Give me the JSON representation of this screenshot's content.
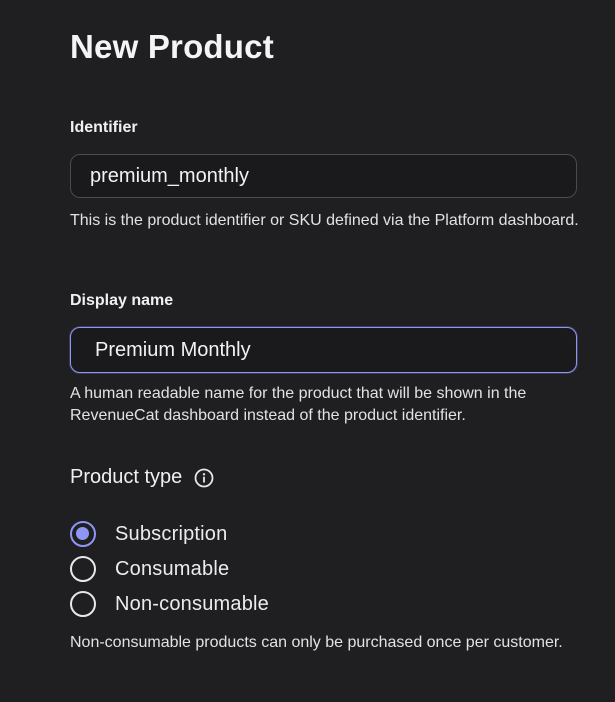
{
  "page": {
    "title": "New Product"
  },
  "identifier": {
    "label": "Identifier",
    "value": "premium_monthly",
    "help": "This is the product identifier or SKU defined via the Platform dashboard."
  },
  "display_name": {
    "label": "Display name",
    "value": "Premium Monthly",
    "help": "A human readable name for the product that will be shown in the RevenueCat dashboard instead of the product identifier."
  },
  "product_type": {
    "label": "Product type",
    "info_icon": "info-icon",
    "options": [
      {
        "label": "Subscription",
        "selected": true
      },
      {
        "label": "Consumable",
        "selected": false
      },
      {
        "label": "Non-consumable",
        "selected": false
      }
    ],
    "help": "Non-consumable products can only be purchased once per customer."
  },
  "colors": {
    "background": "#1f1f21",
    "accent": "#8f95f2",
    "input_background": "#1a1a1c",
    "input_border": "#4a4a50"
  }
}
